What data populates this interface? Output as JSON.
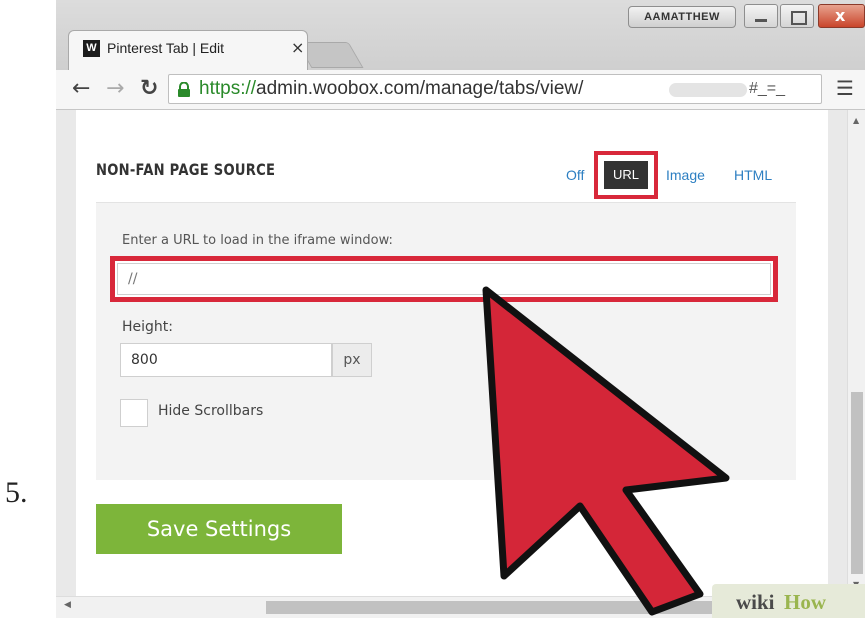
{
  "step": {
    "number": "5."
  },
  "browser": {
    "tab_favicon": "W",
    "tab_title": "Pinterest Tab | Edit",
    "tab_close": "×",
    "user_badge": "AAMATTHEW",
    "window_close": "x",
    "url_https": "https://",
    "url_rest": "admin.woobox.com/manage/tabs/view/",
    "url_hash": "#_=_",
    "icons": {
      "back": "back-arrow-icon",
      "forward": "forward-arrow-icon",
      "reload": "reload-icon",
      "lock": "lock-icon",
      "star": "star-icon",
      "menu": "menu-icon"
    }
  },
  "section": {
    "title": "NON-FAN PAGE SOURCE",
    "tabs": {
      "off": "Off",
      "url": "URL",
      "image": "Image",
      "html": "HTML"
    },
    "selected": "URL"
  },
  "form": {
    "url_label": "Enter a URL to load in the iframe window:",
    "url_value": "//",
    "height_label": "Height:",
    "height_value": "800",
    "height_unit": "px",
    "hide_scrollbars_label": "Hide Scrollbars",
    "hide_scrollbars_checked": false
  },
  "actions": {
    "save_label": "Save Settings"
  },
  "watermark": {
    "wiki": "wiki",
    "how": "How"
  },
  "colors": {
    "highlight": "#d8283a",
    "save_button": "#7db53a",
    "link": "#2d7fc2",
    "https": "#2a8a2a"
  }
}
